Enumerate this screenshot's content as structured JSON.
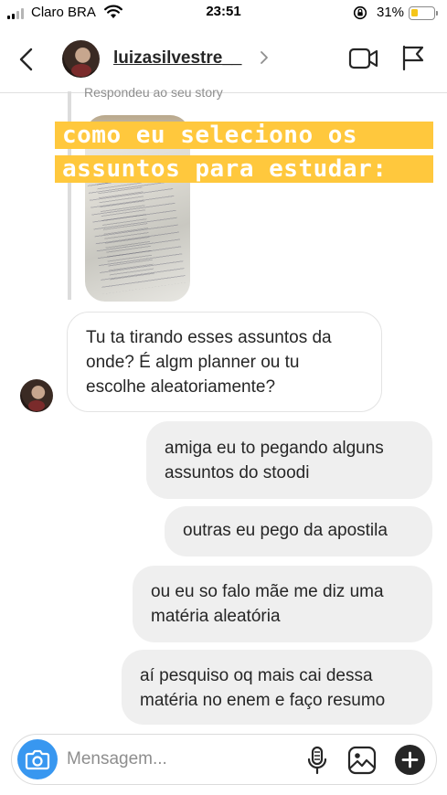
{
  "status_bar": {
    "carrier": "Claro BRA",
    "time": "23:51",
    "battery_percent": "31%",
    "battery_level": 0.31,
    "icons": [
      "signal-icon",
      "wifi-icon",
      "rotation-lock-icon",
      "battery-icon"
    ]
  },
  "header": {
    "username": "luizasilvestre__",
    "icons": [
      "back-chevron-icon",
      "chevron-right-icon",
      "video-call-icon",
      "flag-icon"
    ]
  },
  "story_reply": {
    "label": "Respondeu ao seu story",
    "caption_line_1": "como eu seleciono os",
    "caption_line_2": "assuntos para estudar:",
    "caption_bg_color": "#ffc83d"
  },
  "messages": [
    {
      "direction": "incoming",
      "lines": [
        "Tu ta tirando esses assuntos da",
        "onde? É algm planner ou tu",
        "escolhe aleatoriamente?"
      ]
    },
    {
      "direction": "outgoing",
      "lines": [
        "amiga eu to pegando alguns",
        "assuntos do stoodi"
      ]
    },
    {
      "direction": "outgoing",
      "lines": [
        "outras eu pego da apostila"
      ]
    },
    {
      "direction": "outgoing",
      "lines": [
        "ou eu so falo mãe me diz uma",
        "matéria aleatória"
      ]
    },
    {
      "direction": "outgoing",
      "lines": [
        "aí pesquiso oq mais cai dessa",
        "matéria no enem e faço resumo"
      ]
    }
  ],
  "composer": {
    "placeholder": "Mensagem...",
    "value": "",
    "icons": [
      "camera-icon",
      "microphone-icon",
      "gallery-icon",
      "plus-icon"
    ],
    "accent_color": "#3897f0"
  }
}
